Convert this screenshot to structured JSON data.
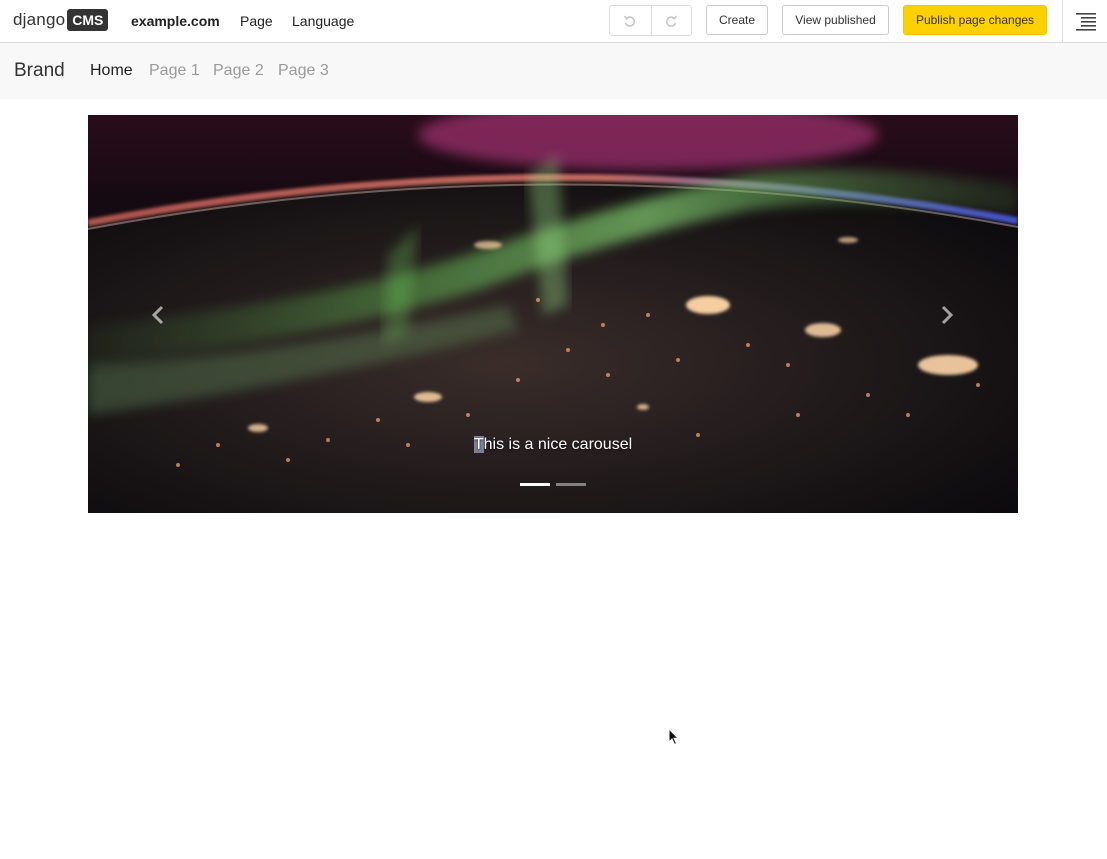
{
  "toolbar": {
    "logo_text": "django",
    "logo_badge": "CMS",
    "site_label": "example.com",
    "page_menu": "Page",
    "language_menu": "Language",
    "undo_icon": "undo-icon",
    "redo_icon": "redo-icon",
    "create_label": "Create",
    "view_published_label": "View published",
    "publish_label": "Publish page changes",
    "structure_icon": "structure-mode-icon",
    "publish_color": "#fdd000"
  },
  "navbar": {
    "brand": "Brand",
    "items": [
      {
        "label": "Home",
        "active": true
      },
      {
        "label": "Page 1",
        "active": false
      },
      {
        "label": "Page 2",
        "active": false
      },
      {
        "label": "Page 3",
        "active": false
      }
    ]
  },
  "carousel": {
    "caption_first": "T",
    "caption_rest": "his is a nice carousel",
    "prev_icon": "chevron-left-icon",
    "next_icon": "chevron-right-icon",
    "indicators": [
      {
        "active": true
      },
      {
        "active": false
      }
    ]
  }
}
